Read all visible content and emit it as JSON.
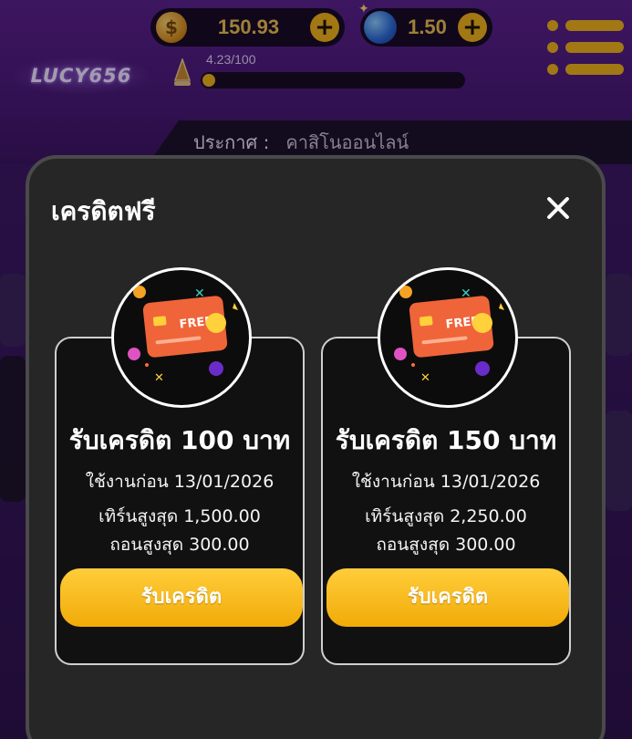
{
  "header": {
    "logo_text": "LUCY656",
    "coin_balance": "150.93",
    "gem_balance": "1.50",
    "xp_text": "4.23/100",
    "xp_progress": 0.0423,
    "announcement_label": "ประกาศ :",
    "announcement_text": "คาสิโนออนไลน์"
  },
  "modal": {
    "title": "เครดิตฟรี",
    "cards": [
      {
        "title": "รับเครดิต 100 บาท",
        "use_before": "ใช้งานก่อน 13/01/2026",
        "max_turnover": "เทิร์นสูงสุด 1,500.00",
        "max_withdraw": "ถอนสูงสุด 300.00",
        "button_label": "รับเครดิต",
        "badge_text": "FREE"
      },
      {
        "title": "รับเครดิต 150 บาท",
        "use_before": "ใช้งานก่อน 13/01/2026",
        "max_turnover": "เทิร์นสูงสุด 2,250.00",
        "max_withdraw": "ถอนสูงสุด 300.00",
        "button_label": "รับเครดิต",
        "badge_text": "FREE"
      }
    ]
  },
  "icons": {
    "coin": "coin-icon",
    "gem": "gem-icon",
    "plus": "plus-icon",
    "menu": "hamburger-menu-icon",
    "rank": "rank-cone-icon",
    "close": "close-icon",
    "free_card": "free-credit-card-icon"
  },
  "colors": {
    "accent": "#f3b514",
    "modal_bg": "#262626",
    "card_bg": "#111111",
    "header_bg": "#4a1876"
  }
}
